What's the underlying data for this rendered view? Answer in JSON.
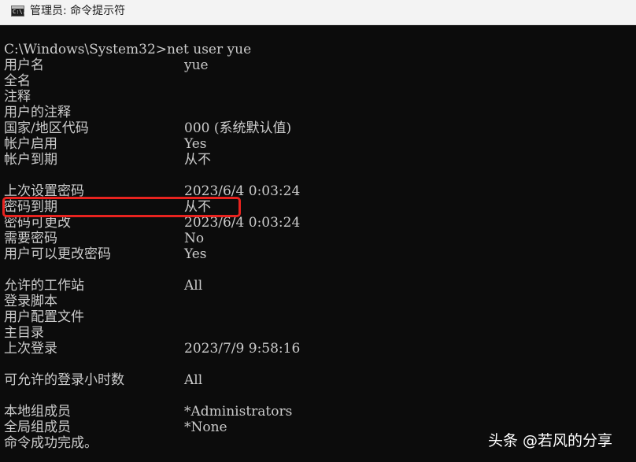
{
  "window": {
    "title": "管理员: 命令提示符",
    "icon": "cmd-icon",
    "icon_glyph": "C:\\."
  },
  "console": {
    "command_line": "C:\\Windows\\System32>net user yue",
    "rows": [
      {
        "label": "用户名",
        "value": "yue"
      },
      {
        "label": "全名",
        "value": ""
      },
      {
        "label": "注释",
        "value": ""
      },
      {
        "label": "用户的注释",
        "value": ""
      },
      {
        "label": "国家/地区代码",
        "value": "000 (系统默认值)"
      },
      {
        "label": "帐户启用",
        "value": "Yes"
      },
      {
        "label": "帐户到期",
        "value": "从不"
      },
      {
        "label": "上次设置密码",
        "value": "2023/6/4 0:03:24"
      },
      {
        "label": "密码到期",
        "value": "从不"
      },
      {
        "label": "密码可更改",
        "value": "2023/6/4 0:03:24"
      },
      {
        "label": "需要密码",
        "value": "No"
      },
      {
        "label": "用户可以更改密码",
        "value": "Yes"
      },
      {
        "label": "允许的工作站",
        "value": "All"
      },
      {
        "label": "登录脚本",
        "value": ""
      },
      {
        "label": "用户配置文件",
        "value": ""
      },
      {
        "label": "主目录",
        "value": ""
      },
      {
        "label": "上次登录",
        "value": "2023/7/9 9:58:16"
      },
      {
        "label": "可允许的登录小时数",
        "value": "All"
      },
      {
        "label": "本地组成员",
        "value": "*Administrators"
      },
      {
        "label": "全局组成员",
        "value": "*None"
      }
    ],
    "completion": "命令成功完成。"
  },
  "annotation": {
    "highlighted_row": "密码到期",
    "color": "#e8231f"
  },
  "watermark": {
    "text": "头条 @若风的分享"
  },
  "colors": {
    "console_bg": "#0c0c0c",
    "console_fg": "#cccccc",
    "titlebar_bg": "#f3f3f3"
  }
}
